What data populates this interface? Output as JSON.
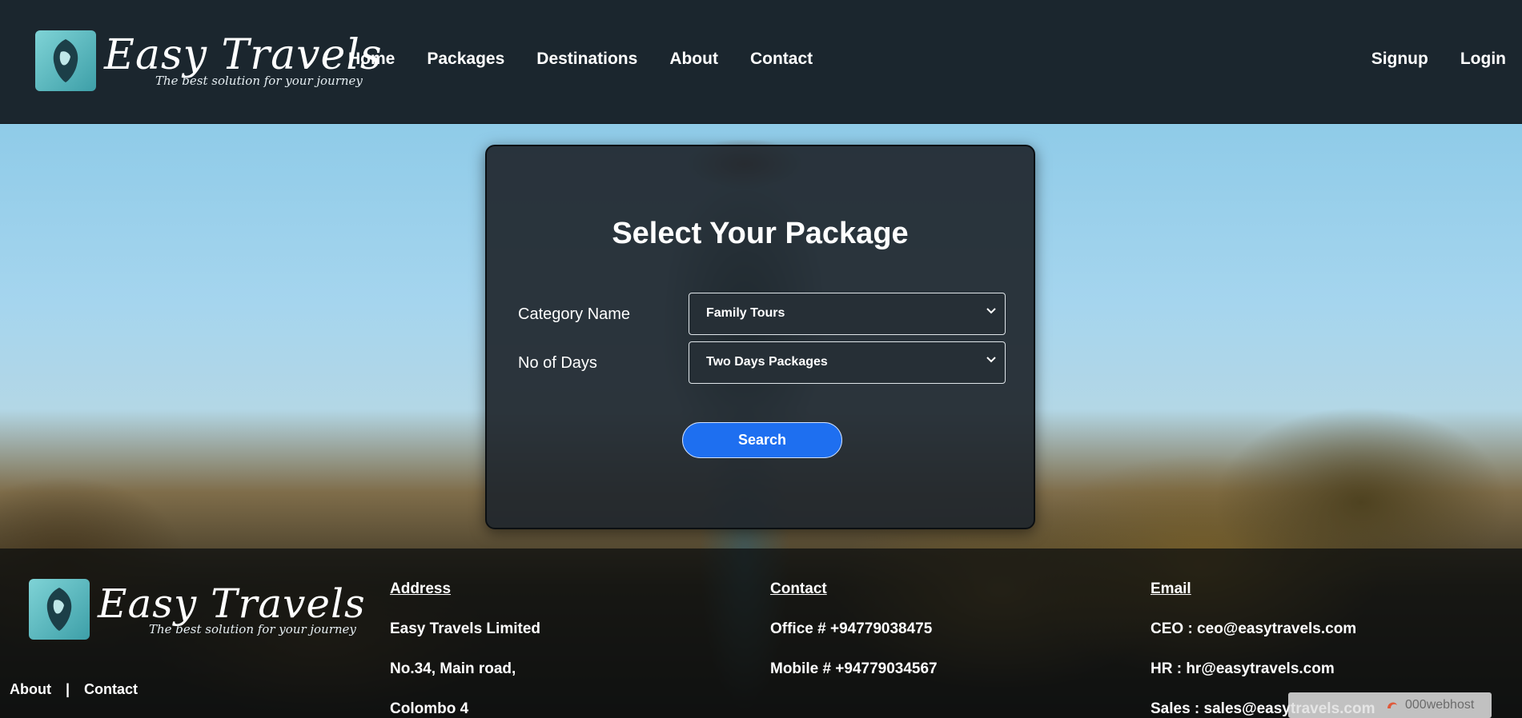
{
  "brand": {
    "name": "Easy Travels",
    "tagline": "The best solution for your journey"
  },
  "nav": {
    "items": [
      "Home",
      "Packages",
      "Destinations",
      "About",
      "Contact"
    ],
    "signup": "Signup",
    "login": "Login"
  },
  "form": {
    "title": "Select Your Package",
    "category_label": "Category Name",
    "category_value": "Family Tours",
    "days_label": "No of Days",
    "days_value": "Two Days Packages",
    "search_label": "Search"
  },
  "footer": {
    "links": [
      "About",
      "|",
      "Contact"
    ],
    "address": {
      "heading": "Address",
      "lines": [
        "Easy Travels Limited",
        "No.34, Main road,",
        "Colombo 4"
      ]
    },
    "contact": {
      "heading": "Contact",
      "lines": [
        "Office # +94779038475",
        "Mobile # +94779034567"
      ]
    },
    "email": {
      "heading": "Email",
      "lines": [
        "CEO : ceo@easytravels.com",
        "HR : hr@easytravels.com",
        "Sales : sales@easytravels.com"
      ]
    }
  },
  "host_badge": "000webhost",
  "colors": {
    "header_bg": "#1b262e",
    "button_blue": "#1e6ff0"
  }
}
